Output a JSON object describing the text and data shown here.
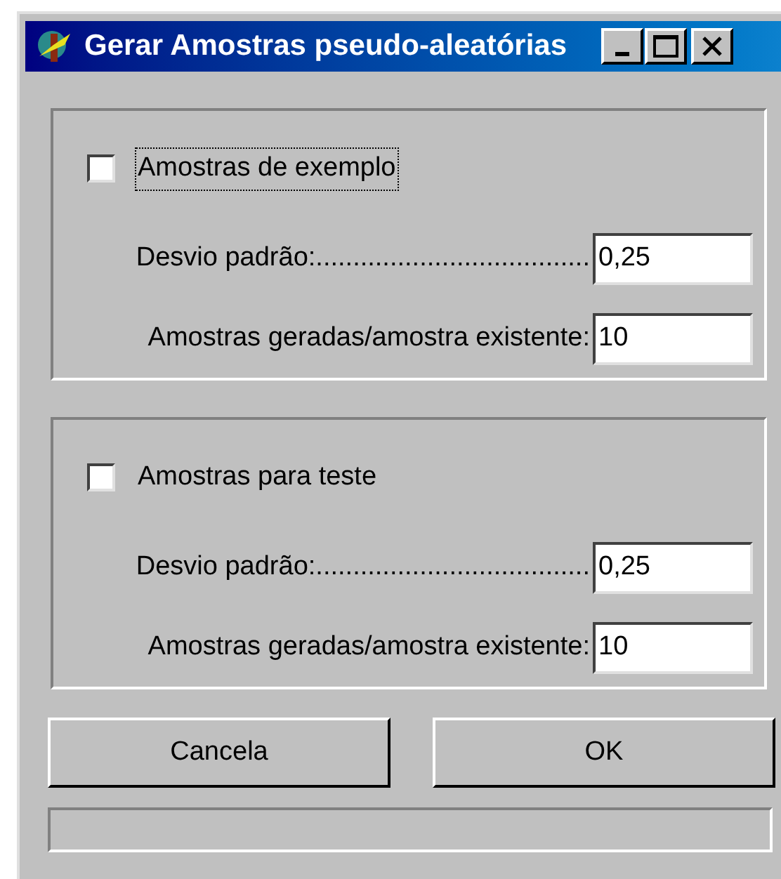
{
  "window": {
    "title": "Gerar Amostras pseudo-aleatórias"
  },
  "groups": [
    {
      "checkbox": {
        "label": "Amostras de exemplo",
        "checked": false,
        "focused": true
      },
      "fields": [
        {
          "label": "Desvio padrão:.....................................",
          "value": "0,25"
        },
        {
          "label": "Amostras geradas/amostra existente:",
          "value": "10"
        }
      ]
    },
    {
      "checkbox": {
        "label": "Amostras para teste",
        "checked": false,
        "focused": false
      },
      "fields": [
        {
          "label": "Desvio padrão:.....................................",
          "value": "0,25"
        },
        {
          "label": "Amostras geradas/amostra existente:",
          "value": "10"
        }
      ]
    }
  ],
  "buttons": [
    "Cancela",
    "OK"
  ]
}
